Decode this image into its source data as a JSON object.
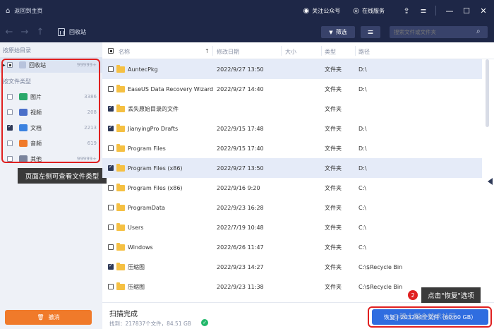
{
  "titlebar": {
    "back_label": "返回到主页",
    "follow_label": "关注公众号",
    "service_label": "在线服务"
  },
  "toolbar": {
    "location": "回收站",
    "filter_label": "筛选",
    "search_placeholder": "搜索文件或文件夹"
  },
  "sidebar": {
    "heading_original": "按原始目录",
    "root_item": {
      "label": "回收站",
      "count": "99999+"
    },
    "heading_type": "按文件类型",
    "type_items": [
      {
        "label": "图片",
        "count": "3386",
        "checked": false,
        "color": "#2aa86a"
      },
      {
        "label": "视频",
        "count": "208",
        "checked": false,
        "color": "#4a6fc9"
      },
      {
        "label": "文档",
        "count": "2213",
        "checked": true,
        "color": "#3b82e0"
      },
      {
        "label": "音频",
        "count": "619",
        "checked": false,
        "color": "#f07a2a"
      },
      {
        "label": "其他",
        "count": "99999+",
        "checked": false,
        "color": "#7a849c"
      }
    ],
    "annotation": "页面左侧可查看文件类型",
    "restore_label": "撤消"
  },
  "table": {
    "columns": {
      "name": "名称",
      "date": "修改日期",
      "size": "大小",
      "type": "类型",
      "path": "路径"
    },
    "rows": [
      {
        "name": "AuntecPkg",
        "date": "2022/9/27 13:50",
        "type": "文件夹",
        "path": "D:\\",
        "checked": false,
        "selected": true
      },
      {
        "name": "EaseUS Data Recovery Wizard",
        "date": "2022/9/27 14:40",
        "type": "文件夹",
        "path": "D:\\",
        "checked": false,
        "selected": false
      },
      {
        "name": "丢失原始目录的文件",
        "date": "",
        "type": "文件夹",
        "path": "",
        "checked": true,
        "selected": false
      },
      {
        "name": "JianyingPro Drafts",
        "date": "2022/9/15 17:48",
        "type": "文件夹",
        "path": "D:\\",
        "checked": true,
        "selected": false
      },
      {
        "name": "Program Files",
        "date": "2022/9/15 17:40",
        "type": "文件夹",
        "path": "D:\\",
        "checked": false,
        "selected": false
      },
      {
        "name": "Program Files (x86)",
        "date": "2022/9/27 13:50",
        "type": "文件夹",
        "path": "D:\\",
        "checked": true,
        "selected": true
      },
      {
        "name": "Program Files (x86)",
        "date": "2022/9/16 9:20",
        "type": "文件夹",
        "path": "C:\\",
        "checked": false,
        "selected": false
      },
      {
        "name": "ProgramData",
        "date": "2022/9/23 16:28",
        "type": "文件夹",
        "path": "C:\\",
        "checked": false,
        "selected": false
      },
      {
        "name": "Users",
        "date": "2022/7/19 10:48",
        "type": "文件夹",
        "path": "C:\\",
        "checked": false,
        "selected": false
      },
      {
        "name": "Windows",
        "date": "2022/6/26 11:47",
        "type": "文件夹",
        "path": "C:\\",
        "checked": false,
        "selected": false
      },
      {
        "name": "压缩图",
        "date": "2022/9/23 14:27",
        "type": "文件夹",
        "path": "C:\\$Recycle Bin",
        "checked": true,
        "selected": false
      },
      {
        "name": "压缩图",
        "date": "2022/9/23 11:38",
        "type": "文件夹",
        "path": "C:\\$Recycle Bin",
        "checked": false,
        "selected": false
      }
    ]
  },
  "status": {
    "title": "扫描完成",
    "found": "找到：217837个文件，84.51 GB"
  },
  "recover": {
    "label": "恢复 | 203294个文件（60.60 GB）",
    "annotation": "点击\"恢复\"选项",
    "badge": "2"
  },
  "watermark": "@稀土掘金技术社区"
}
